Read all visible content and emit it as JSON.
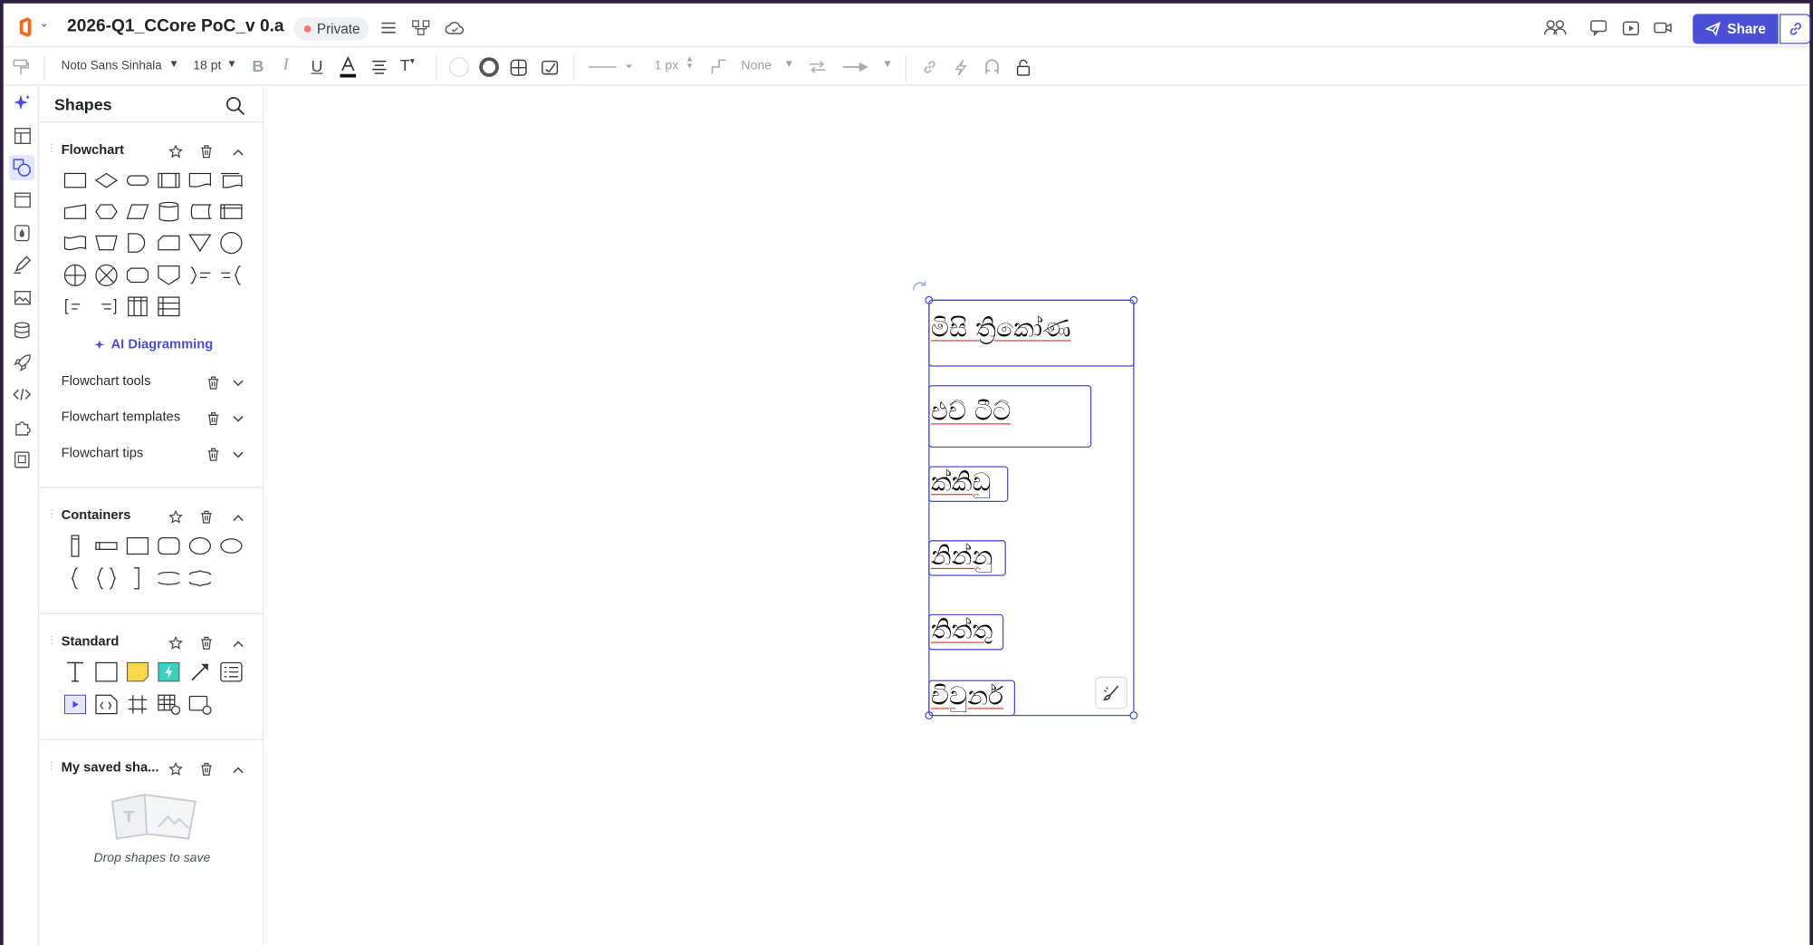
{
  "header": {
    "doc_title": "2026-Q1_CCore PoC_v 0.a",
    "privacy_label": "Private",
    "share_label": "Share"
  },
  "toolbar": {
    "font_family": "Noto Sans Sinhala",
    "font_size": "18 pt",
    "line_width": "1 px",
    "endpoint": "None"
  },
  "panel": {
    "title": "Shapes",
    "sections": {
      "flowchart": "Flowchart",
      "containers": "Containers",
      "standard": "Standard",
      "saved": "My saved sha..."
    },
    "ai_diagramming": "AI Diagramming",
    "sub_rows": [
      "Flowchart tools",
      "Flowchart templates",
      "Flowchart tips"
    ],
    "drop_text": "Drop shapes to save"
  },
  "canvas": {
    "boxes": [
      "මිසි ත්‍රිකෝණ",
      "එච් ටීට්",
      "ක්කිඩු",
      "නින්නු",
      "තිත්තු",
      "චිවුනර්"
    ]
  },
  "colors": {
    "accent": "#4a4fd6",
    "frame": "#2b1e40",
    "spellcheck": "#e0474c",
    "sticky_note": "#f8d849",
    "action_shape": "#3ccfc2",
    "logo": "#f26b1d"
  }
}
